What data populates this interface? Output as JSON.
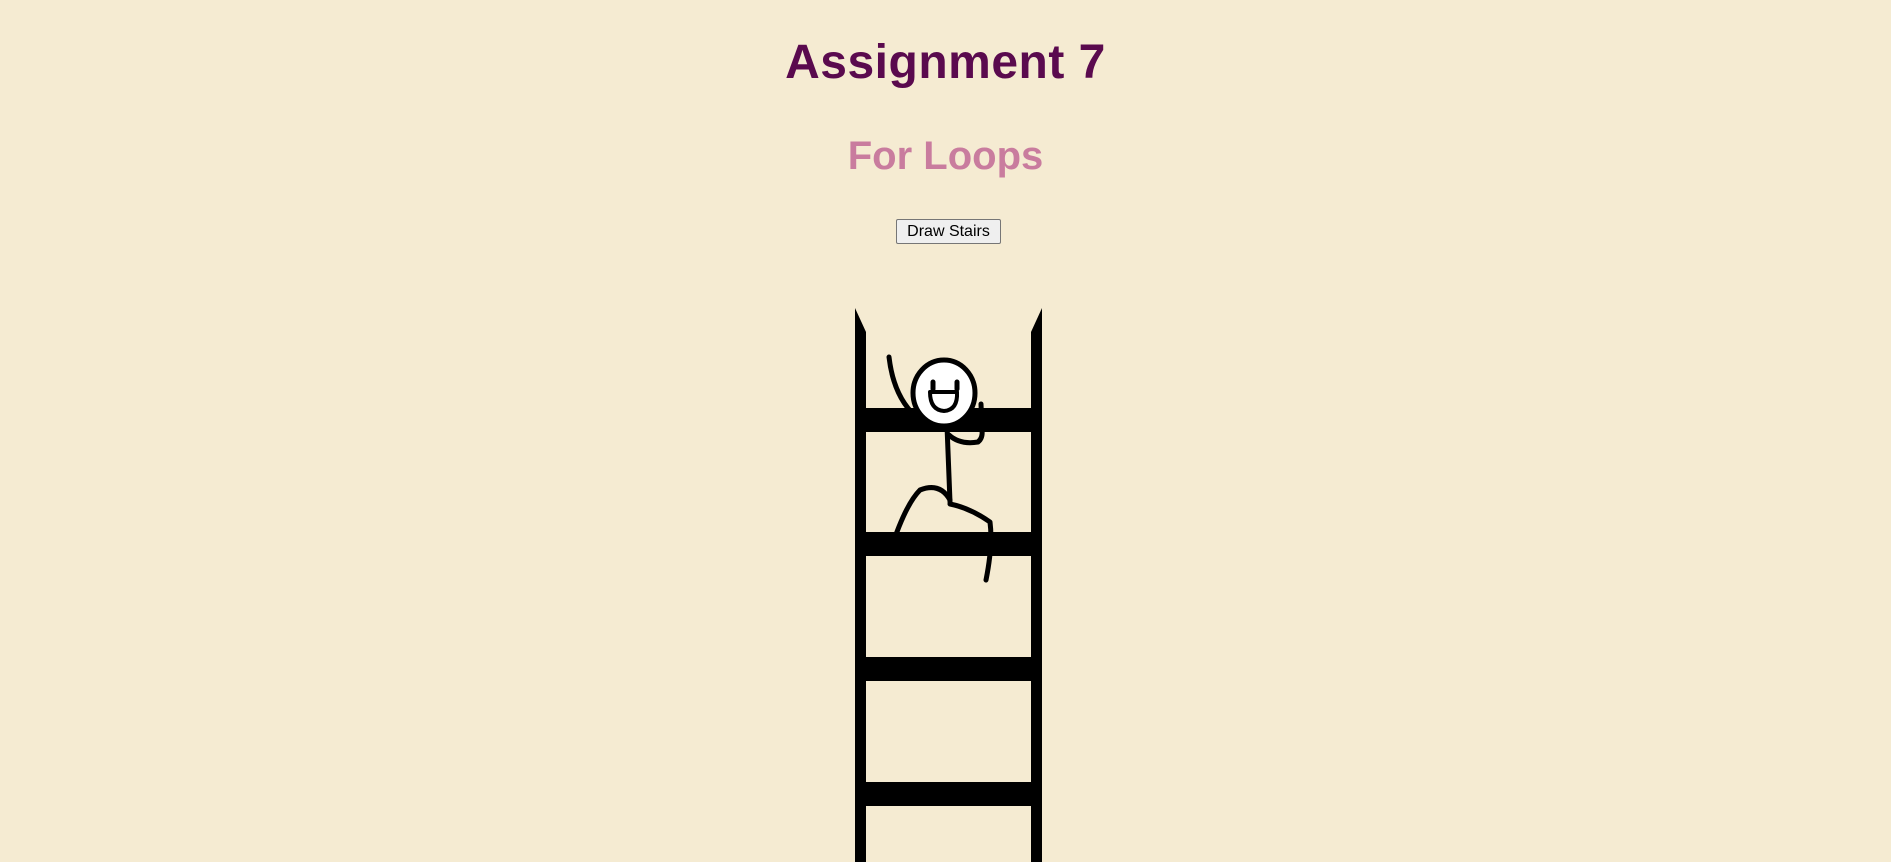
{
  "page": {
    "title": "Assignment 7",
    "subtitle": "For Loops",
    "background_color": "#f5ebd2",
    "title_color": "#5a0a4e",
    "subtitle_color": "#c97c9e"
  },
  "controls": {
    "draw_button_label": "Draw Stairs"
  },
  "illustration": {
    "subject": "stick figure climbing a ladder",
    "icon": "stick-figure-icon",
    "visible_rungs": 4,
    "ink_color": "#000000"
  }
}
